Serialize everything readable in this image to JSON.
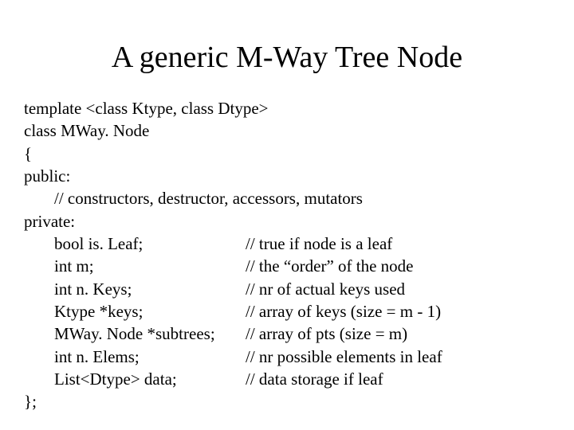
{
  "title": "A generic M-Way Tree Node",
  "code": {
    "line0": "template <class Ktype, class Dtype>",
    "line1": "class MWay. Node",
    "line2": "{",
    "line3": "public:",
    "line4": "// constructors, destructor, accessors, mutators",
    "line5": "private:",
    "members": [
      {
        "decl": "bool is. Leaf;",
        "comment": "// true if node is a leaf"
      },
      {
        "decl": "int   m;",
        "comment": "// the “order” of the node"
      },
      {
        "decl": "int   n. Keys;",
        "comment": "// nr of actual keys used"
      },
      {
        "decl": "Ktype *keys;",
        "comment": "// array of keys (size = m - 1)"
      },
      {
        "decl": "MWay. Node *subtrees;",
        "comment": "// array of pts (size = m)"
      },
      {
        "decl": "int   n. Elems;",
        "comment": "// nr possible elements in leaf"
      },
      {
        "decl": "List<Dtype> data;",
        "comment": "// data storage if leaf"
      }
    ],
    "lineEnd": "};"
  }
}
